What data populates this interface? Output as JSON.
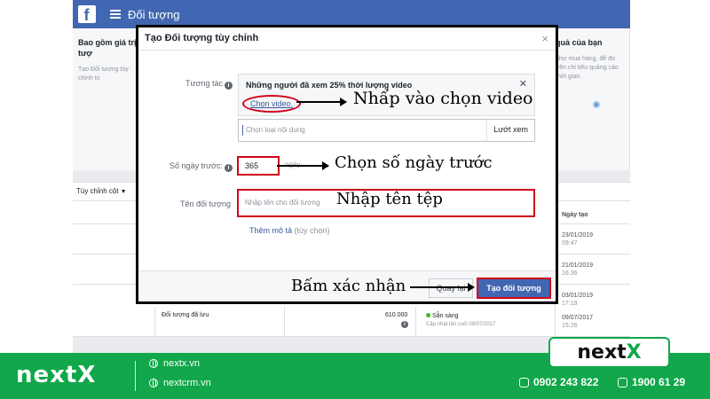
{
  "fb": {
    "logo": "f",
    "title": "Đối tượng",
    "left_panel": {
      "heading": "Bao gồm giá trị tượ",
      "desc": "Tạo Đối tượng tùy chỉnh trị"
    },
    "right_panel": {
      "heading": "quả của bạn",
      "desc": "như mua hàng, để đo trên chi tiêu quảng cáo thời gian."
    },
    "columns_button": "Tùy chỉnh cột",
    "date_header": "Ngày tạo",
    "rows": [
      {
        "date": "23/01/2019",
        "time": "09:47"
      },
      {
        "date": "21/01/2019",
        "time": "16:36"
      },
      {
        "date": "03/01/2019",
        "time": "17:19"
      },
      {
        "name": "Đối tượng đã lưu",
        "size": "610.000",
        "status": "Sẵn sàng",
        "status_sub": "Cập nhật lần cuối 09/07/2017",
        "date": "09/07/2017",
        "time": "15:26"
      }
    ]
  },
  "modal": {
    "title": "Tạo Đối tượng tùy chỉnh",
    "close": "×",
    "engagement_label": "Tương tác",
    "engagement_value": "Những người đã xem 25% thời lượng video",
    "engagement_remove": "✕",
    "choose_video": "Chọn video.",
    "content_placeholder": "Chọn loại nội dung",
    "browse": "Lướt xem",
    "days_label": "Số ngày trước:",
    "days_value": "365",
    "days_unit": "ngày",
    "name_label": "Tên đối tượng",
    "name_placeholder": "Nhập tên cho đối tượng",
    "add_desc": "Thêm mô tả",
    "add_desc_optional": "(tùy chọn)",
    "back_button": "Quay lại",
    "create_button": "Tạo đối tượng",
    "info_glyph": "i"
  },
  "annotations": {
    "choose_video": "Nhấp vào chọn video",
    "days": "Chọn số ngày trước",
    "name": "Nhập tên tệp",
    "confirm": "Bấm xác nhận"
  },
  "footer": {
    "brand": "nextX",
    "link1": "nextx.vn",
    "link2": "nextcrm.vn",
    "phone1": "0902 243 822",
    "phone2": "1900 61 29",
    "logo_text": "next",
    "logo_accent": "X"
  },
  "colors": {
    "fb_blue": "#4267b2",
    "highlight_red": "#d0021b",
    "brand_green": "#11a74a"
  }
}
